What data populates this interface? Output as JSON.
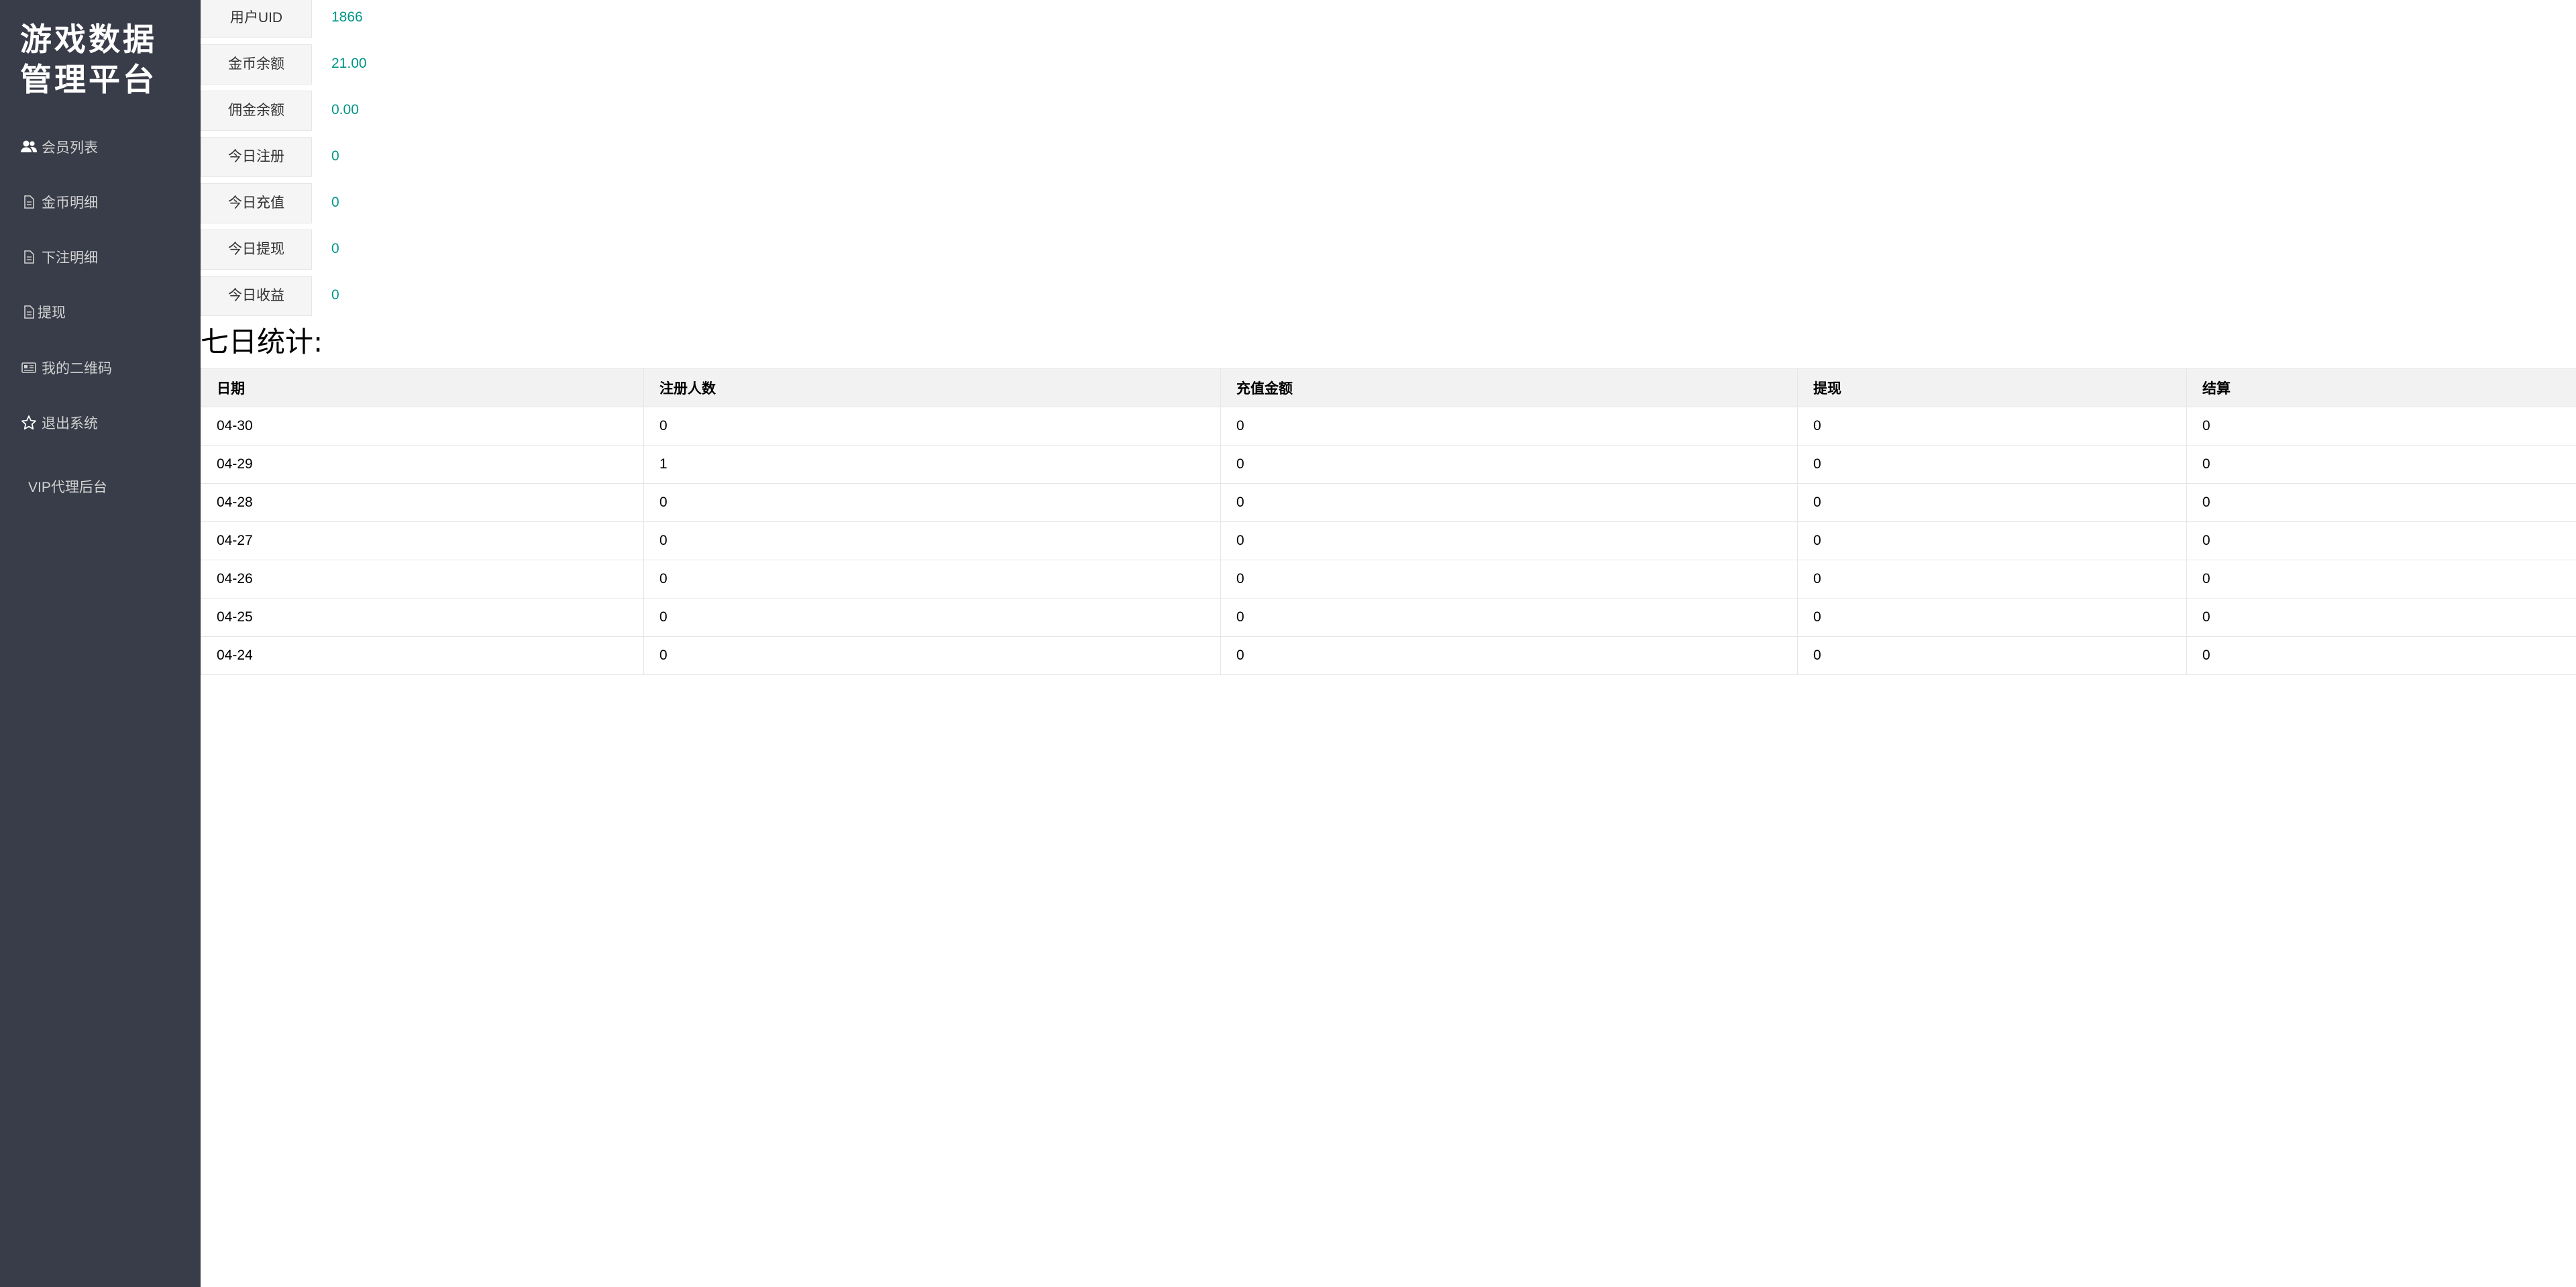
{
  "sidebar": {
    "brand_line1": "游戏数据",
    "brand_line2": "管理平台",
    "items": [
      {
        "label": "会员列表",
        "icon": "users-icon"
      },
      {
        "label": "金币明细",
        "icon": "document-icon"
      },
      {
        "label": "下注明细",
        "icon": "document-icon"
      },
      {
        "label": "提现",
        "icon": "document-icon"
      },
      {
        "label": "我的二维码",
        "icon": "qrcode-icon"
      },
      {
        "label": "退出系统",
        "icon": "star-icon"
      },
      {
        "label": "VIP代理后台",
        "icon": ""
      }
    ]
  },
  "info": [
    {
      "label": "用户UID",
      "value": "1866"
    },
    {
      "label": "金币余额",
      "value": "21.00"
    },
    {
      "label": "佣金余额",
      "value": "0.00"
    },
    {
      "label": "今日注册",
      "value": "0"
    },
    {
      "label": "今日充值",
      "value": "0"
    },
    {
      "label": "今日提现",
      "value": "0"
    },
    {
      "label": "今日收益",
      "value": "0"
    }
  ],
  "section_title": "七日统计:",
  "table": {
    "headers": [
      "日期",
      "注册人数",
      "充值金额",
      "提现",
      "结算"
    ],
    "rows": [
      [
        "04-30",
        "0",
        "0",
        "0",
        "0"
      ],
      [
        "04-29",
        "1",
        "0",
        "0",
        "0"
      ],
      [
        "04-28",
        "0",
        "0",
        "0",
        "0"
      ],
      [
        "04-27",
        "0",
        "0",
        "0",
        "0"
      ],
      [
        "04-26",
        "0",
        "0",
        "0",
        "0"
      ],
      [
        "04-25",
        "0",
        "0",
        "0",
        "0"
      ],
      [
        "04-24",
        "0",
        "0",
        "0",
        "0"
      ]
    ]
  },
  "colors": {
    "sidebar_bg": "#393d49",
    "accent": "#009688"
  }
}
